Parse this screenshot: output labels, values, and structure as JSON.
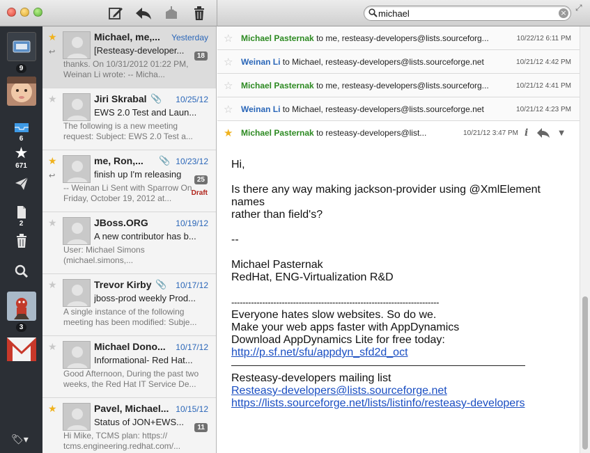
{
  "search": {
    "query": "michael"
  },
  "sidebar": {
    "account_count": "9",
    "inbox_count": "6",
    "starred_count": "671",
    "drafts_count": "2",
    "account2_count": "3"
  },
  "messages": [
    {
      "sender": "Michael, me,...",
      "date": "Yesterday",
      "subject": "[Resteasy-developer...",
      "preview": "thanks. On 10/31/2012 01:22 PM, Weinan Li wrote: -- Micha...",
      "badge": "18",
      "starred": true,
      "replied": true
    },
    {
      "sender": "Jiri Skrabal",
      "date": "10/25/12",
      "subject": "EWS 2.0 Test and Laun...",
      "preview": "The following is a new meeting request: Subject: EWS 2.0 Test a...",
      "starred": false,
      "attachment": true
    },
    {
      "sender": "me, Ron,...",
      "date": "10/23/12",
      "subject": "finish up I'm releasing",
      "preview": "-- Weinan Li Sent with Sparrow On Friday, October 19, 2012 at...",
      "badge": "25",
      "draft": "Draft",
      "starred": true,
      "replied": true,
      "attachment": true
    },
    {
      "sender": "JBoss.ORG",
      "date": "10/19/12",
      "subject": "A new contributor has b...",
      "preview": "User: Michael Simons (michael.simons,...",
      "starred": false
    },
    {
      "sender": "Trevor Kirby",
      "date": "10/17/12",
      "subject": "jboss-prod weekly Prod...",
      "preview": "A single instance of the following meeting has been modified: Subje...",
      "starred": false,
      "attachment": true
    },
    {
      "sender": "Michael Dono...",
      "date": "10/17/12",
      "subject": "Informational- Red Hat...",
      "preview": "Good Afternoon, During the past two weeks, the Red Hat IT Service De...",
      "starred": false
    },
    {
      "sender": "Pavel, Michael...",
      "date": "10/15/12",
      "subject": "Status of JON+EWS...",
      "preview": "Hi Mike, TCMS plan: https:// tcms.engineering.redhat.com/...",
      "badge": "11",
      "starred": true
    }
  ],
  "thread": [
    {
      "from": "Michael Pasternak",
      "to": "to me, resteasy-developers@lists.sourceforg...",
      "date": "10/22/12 6:11 PM",
      "color": "#2d8a22"
    },
    {
      "from": "Weinan Li",
      "to": "to Michael, resteasy-developers@lists.sourceforge.net",
      "date": "10/21/12 4:42 PM",
      "color": "#2a66b8"
    },
    {
      "from": "Michael Pasternak",
      "to": "to me, resteasy-developers@lists.sourceforg...",
      "date": "10/21/12 4:41 PM",
      "color": "#2d8a22"
    },
    {
      "from": "Weinan Li",
      "to": "to Michael, resteasy-developers@lists.sourceforge.net",
      "date": "10/21/12 4:23 PM",
      "color": "#2a66b8"
    }
  ],
  "open_message": {
    "from": "Michael Pasternak",
    "to": "to resteasy-developers@list...",
    "date": "10/21/12 3:47 PM",
    "greeting": "Hi,",
    "line1": "Is there any way making jackson-provider using @XmlElement names",
    "line2": "rather than field's?",
    "sig_dash": "--",
    "sig_name": "Michael Pasternak",
    "sig_org": "RedHat, ENG-Virtualization R&D",
    "dash_rule": "--------------------------------------------------------------------------",
    "ad1": "Everyone hates slow websites. So do we.",
    "ad2": "Make your web apps faster with AppDynamics",
    "ad3": "Download AppDynamics Lite for free today:",
    "ad_link": "http://p.sf.net/sfu/appdyn_sfd2d_oct",
    "list_name": "Resteasy-developers mailing list",
    "list_email": "Resteasy-developers@lists.sourceforge.net",
    "list_url": "https://lists.sourceforge.net/lists/listinfo/resteasy-developers"
  }
}
